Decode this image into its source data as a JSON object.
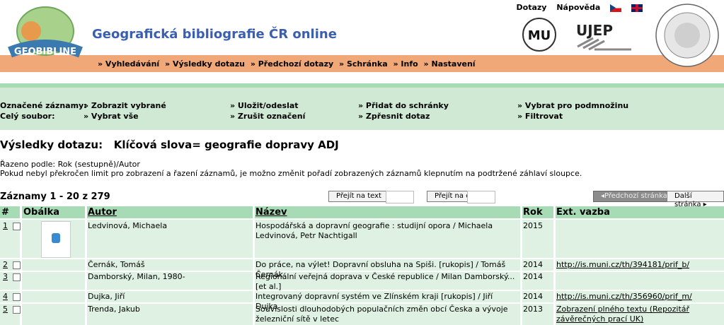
{
  "top_links": {
    "queries": "Dotazy",
    "help": "Nápověda"
  },
  "site_title": "Geografická bibliografie ČR online",
  "logos": {
    "geobibline": "GEOBIBLINE",
    "mu": "MU",
    "ujep": "UJEP"
  },
  "nav": [
    "» Vyhledávání",
    "» Výsledky dotazu",
    "» Předchozí dotazy",
    "» Schránka",
    "» Info",
    "» Nastavení"
  ],
  "actions": {
    "marked_label": "Označené záznamy:",
    "all_label": "Celý soubor:",
    "show_selected": "» Zobrazit vybrané",
    "save_send": "» Uložit/odeslat",
    "add_box": "» Přidat do schránky",
    "select_subset": "» Vybrat pro podmnožinu",
    "select_all": "» Vybrat vše",
    "cancel_marks": "» Zrušit označení",
    "refine": "» Zpřesnit dotaz",
    "filter": "» Filtrovat"
  },
  "results_title": "Výsledky dotazu:   Klíčová slova= geografie dopravy ADJ",
  "sorted_by": "Řazeno podle: Rok (sestupně)/Autor",
  "sort_note": "Pokud nebyl překročen limit pro zobrazení a řazení záznamů, je možno změnit pořadí zobrazených záznamů klepnutím na podtržené záhlaví sloupce.",
  "records": "Záznamy 1 - 20 z 279",
  "goto_text": "Přejít na text",
  "goto_no": "Přejít na č.",
  "prev_page": "Předchozí stránka",
  "next_page": "Další stránka",
  "columns": {
    "num": "#",
    "cover": "Obálka",
    "author": "Autor",
    "title": "Název",
    "year": "Rok",
    "link": "Ext. vazba"
  },
  "rows": [
    {
      "n": "1",
      "author": "Ledvinová, Michaela",
      "title": "Hospodářská a dopravní geografie : studijní opora / Michaela Ledvinová, Petr Nachtigall",
      "year": "2015",
      "link": ""
    },
    {
      "n": "2",
      "author": "Černák, Tomáš",
      "title": "Do práce, na výlet! Dopravní obsluha na Spiši. [rukopis] / Tomáš Černák",
      "year": "2014",
      "link": "http://is.muni.cz/th/394181/prif_b/"
    },
    {
      "n": "3",
      "author": "Damborský, Milan, 1980-",
      "title": "Regionální veřejná doprava v České republice / Milan Damborský... [et al.]",
      "year": "2014",
      "link": ""
    },
    {
      "n": "4",
      "author": "Dujka, Jiří",
      "title": "Integrovaný dopravní systém ve Zlínském kraji [rukopis] / Jiří Dujka",
      "year": "2014",
      "link": "http://is.muni.cz/th/356960/prif_m/"
    },
    {
      "n": "5",
      "author": "Trenda, Jakub",
      "title": "Souvislosti dlouhodobých populačních změn obcí Česka a vývoje železniční sítě v letec",
      "year": "2013",
      "link": "Zobrazení plného textu (Repozitář závěrečných prací UK)"
    }
  ]
}
